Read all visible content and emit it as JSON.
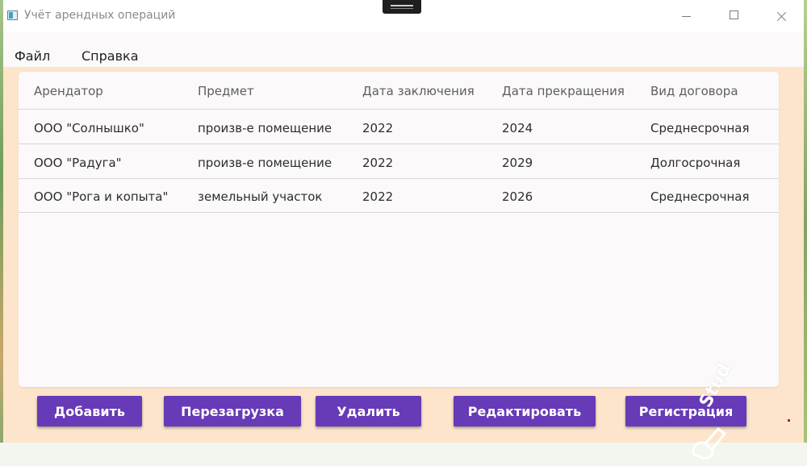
{
  "window": {
    "title": "Учёт арендных операций"
  },
  "menu": {
    "file": "Файл",
    "help": "Справка"
  },
  "table": {
    "columns": [
      "Арендатор",
      "Предмет",
      "Дата заключения",
      "Дата прекращения",
      "Вид договора"
    ],
    "rows": [
      [
        "ООО \"Солнышко\"",
        "произв-е помещение",
        "2022",
        "2024",
        "Среднесрочная"
      ],
      [
        "ООО \"Радуга\"",
        "произв-е помещение",
        "2022",
        "2029",
        "Долгосрочная"
      ],
      [
        "ООО \"Рога и копыта\"",
        "земельный участок",
        "2022",
        "2026",
        "Среднесрочная"
      ]
    ]
  },
  "buttons": {
    "add": "Добавить",
    "reload": "Перезагрузка",
    "delete": "Удалить",
    "edit": "Редактировать",
    "register": "Регистрация"
  },
  "watermark": {
    "text": "Stud"
  },
  "colors": {
    "accent": "#673ab7",
    "content_bg": "#fde5cb",
    "grid_bg": "#fbf9f9"
  },
  "icons": {
    "app": "app-icon",
    "minimize": "minimize-icon",
    "maximize": "maximize-icon",
    "close": "close-icon"
  }
}
